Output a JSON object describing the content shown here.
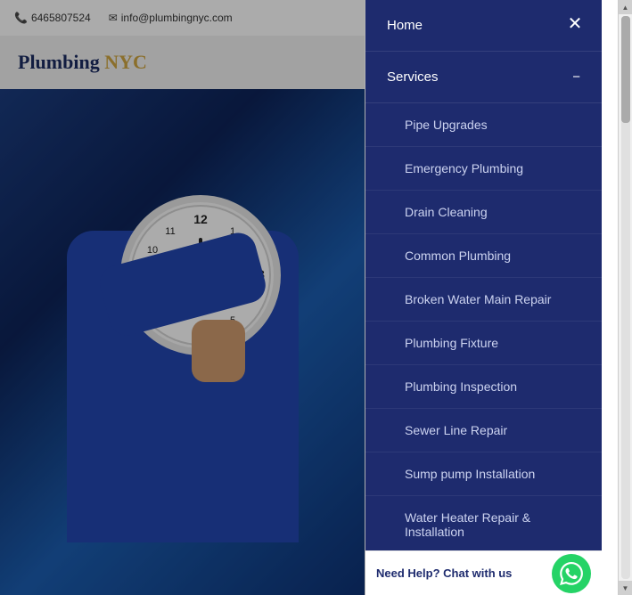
{
  "header": {
    "phone": "6465807524",
    "email": "info@plumbingnyc.com",
    "phone_icon": "📞",
    "email_icon": "✉",
    "instagram_icon": "instagram"
  },
  "logo": {
    "text_plumbing": "Plumbing",
    "text_nyc": "NYC"
  },
  "nav": {
    "close_icon": "✕",
    "home_label": "Home",
    "services_label": "Services",
    "services_toggle": "−",
    "sub_items": [
      {
        "label": "Pipe Upgrades"
      },
      {
        "label": "Emergency Plumbing"
      },
      {
        "label": "Drain Cleaning"
      },
      {
        "label": "Common Plumbing"
      },
      {
        "label": "Broken Water Main Repair"
      },
      {
        "label": "Plumbing Fixture"
      },
      {
        "label": "Plumbing Inspection"
      },
      {
        "label": "Sewer Line Repair"
      },
      {
        "label": "Sump pump Installation"
      },
      {
        "label": "Water Heater Repair & Installation"
      }
    ]
  },
  "chat": {
    "prefix": "Need Help?",
    "cta": "Chat with us",
    "whatsapp_icon": "💬"
  },
  "scrollbar": {
    "up_arrow": "▲",
    "down_arrow": "▼"
  }
}
